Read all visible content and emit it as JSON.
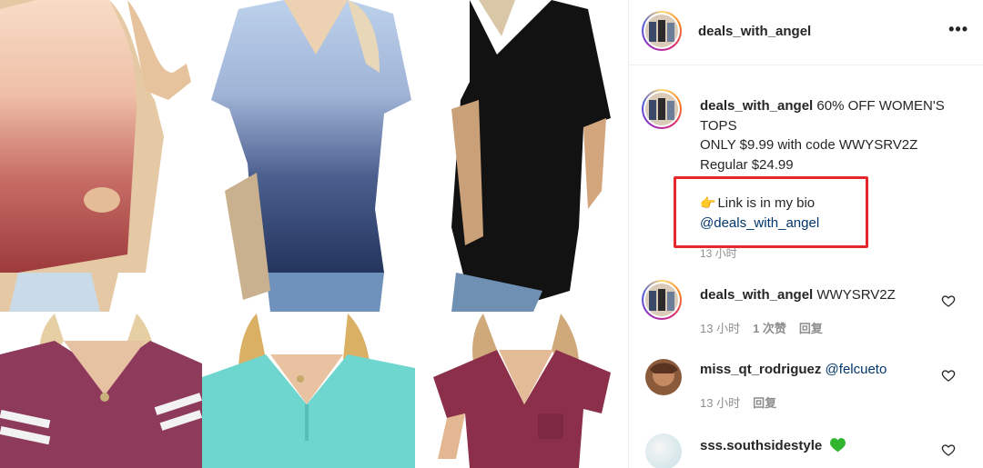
{
  "post": {
    "username": "deals_with_angel",
    "more_label": "•••",
    "caption": {
      "username": "deals_with_angel",
      "line1": " 60% OFF WOMEN'S",
      "line2": "TOPS",
      "line3": "ONLY $9.99 with code WWYSRV2Z",
      "line4": "Regular $24.99",
      "link_text": "Link is in my bio",
      "link_icon": "pointing-hand-emoji",
      "mention": "@deals_with_angel",
      "time": "13 小时"
    },
    "highlight_color": "#e5262b"
  },
  "products": [
    {
      "name": "peach-ombre-vneck-tee",
      "color_top": "#f6d7bf",
      "color_bottom": "#a6423f"
    },
    {
      "name": "blue-ombre-vneck-tee",
      "color_top": "#b9cde8",
      "color_bottom": "#283a63"
    },
    {
      "name": "black-vneck-tee",
      "color_top": "#141414",
      "color_bottom": "#0c0c0c"
    },
    {
      "name": "plum-striped-sleeve-tee",
      "color_top": "#8d3a5b",
      "color_bottom": "#8d3a5b"
    },
    {
      "name": "aqua-henley-vneck-tee",
      "color_top": "#6fd6cf",
      "color_bottom": "#6fd6cf"
    },
    {
      "name": "wine-pocket-vneck-tee",
      "color_top": "#8c2f4a",
      "color_bottom": "#8c2f4a"
    }
  ],
  "comments": [
    {
      "username": "deals_with_angel",
      "text": " WWYSRV2Z",
      "time": "13 小时",
      "likes": "1 次赞",
      "reply": "回复"
    },
    {
      "username": "miss_qt_rodriguez",
      "text": " ",
      "mention": "@felcueto",
      "time": "13 小时",
      "reply": "回复"
    },
    {
      "username": "sss.southsidestyle",
      "emoji": "green-heart-emoji"
    }
  ],
  "colors": {
    "text": "#262626",
    "muted": "#8e8e8e",
    "link": "#00376b",
    "border": "#efefef"
  }
}
